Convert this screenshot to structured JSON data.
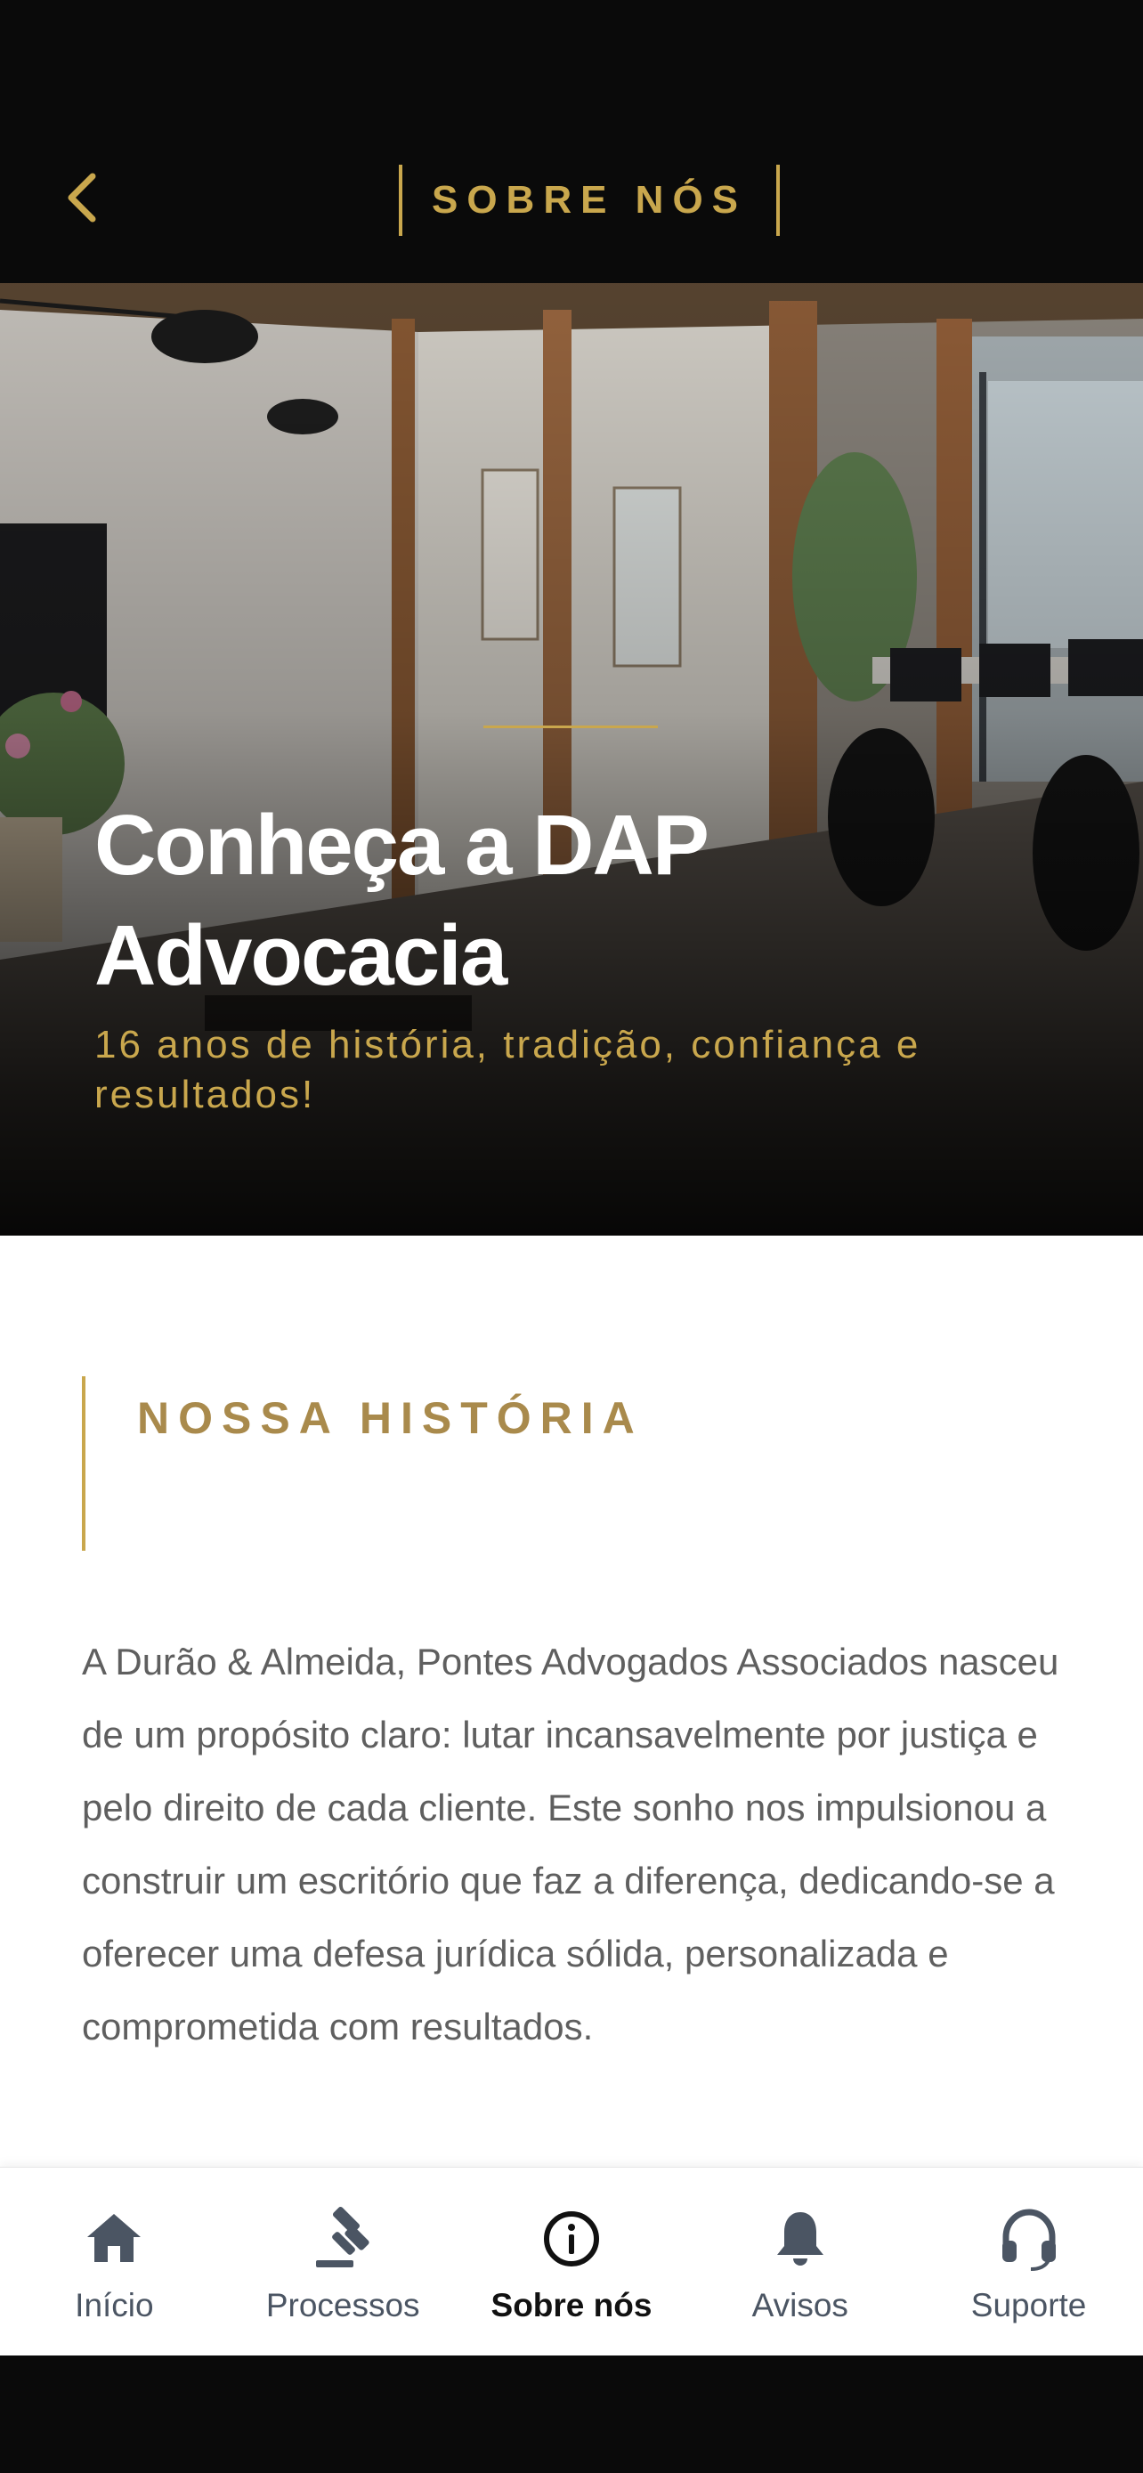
{
  "header": {
    "title": "SOBRE NÓS",
    "back_icon": "chevron-left-icon"
  },
  "hero": {
    "heading": "Conheça a DAP Advocacia",
    "subtitle": "16 anos de história, tradição, confiança e resultados!"
  },
  "history": {
    "title": "NOSSA HISTÓRIA",
    "body": "A Durão & Almeida, Pontes Advogados Associados nasceu de um propósito claro: lutar incansavelmente por justiça e pelo direito de cada cliente. Este sonho nos impulsionou a construir um escritório que faz a diferença, dedicando-se a oferecer uma defesa jurídica sólida, personalizada e comprometida com resultados."
  },
  "tabbar": {
    "items": [
      {
        "label": "Início",
        "icon": "home-icon",
        "active": false
      },
      {
        "label": "Processos",
        "icon": "gavel-icon",
        "active": false
      },
      {
        "label": "Sobre nós",
        "icon": "info-icon",
        "active": true
      },
      {
        "label": "Avisos",
        "icon": "bell-icon",
        "active": false
      },
      {
        "label": "Suporte",
        "icon": "headset-icon",
        "active": false
      }
    ]
  },
  "colors": {
    "accent": "#c9a74d",
    "dark": "#0a0a0a",
    "text": "#5f5f5f"
  }
}
